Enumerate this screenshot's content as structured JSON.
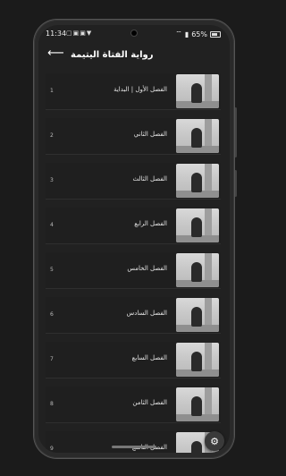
{
  "status_bar": {
    "time": "11:34",
    "left_icons": "▢▣▣▼",
    "battery": "65%"
  },
  "app_bar": {
    "title": "رواية الفتاة اليتيمة"
  },
  "chapters": [
    {
      "number": "1",
      "title": "الفصل الأول | البداية"
    },
    {
      "number": "2",
      "title": "الفصل الثاني"
    },
    {
      "number": "3",
      "title": "الفصل الثالث"
    },
    {
      "number": "4",
      "title": "الفصل الرابع"
    },
    {
      "number": "5",
      "title": "الفصل الخامس"
    },
    {
      "number": "6",
      "title": "الفصل السادس"
    },
    {
      "number": "7",
      "title": "الفصل السابع"
    },
    {
      "number": "8",
      "title": "الفصل الثامن"
    },
    {
      "number": "9",
      "title": "الفصل التاسع"
    }
  ],
  "icons": {
    "back": "arrow-left-icon",
    "settings": "gear-icon"
  }
}
